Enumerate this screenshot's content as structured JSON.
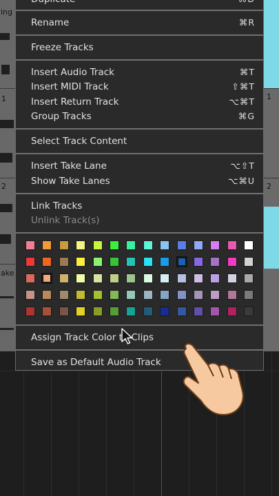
{
  "menu": {
    "items": {
      "duplicate": {
        "label": "Duplicate",
        "shortcut": "⌘D"
      },
      "rename": {
        "label": "Rename",
        "shortcut": "⌘R"
      },
      "freeze": {
        "label": "Freeze Tracks"
      },
      "insert_audio": {
        "label": "Insert Audio Track",
        "shortcut": "⌘T"
      },
      "insert_midi": {
        "label": "Insert MIDI Track",
        "shortcut": "⇧⌘T"
      },
      "insert_return": {
        "label": "Insert Return Track",
        "shortcut": "⌥⌘T"
      },
      "group": {
        "label": "Group Tracks",
        "shortcut": "⌘G"
      },
      "select_content": {
        "label": "Select Track Content"
      },
      "insert_take_lane": {
        "label": "Insert Take Lane",
        "shortcut": "⌥⇧T"
      },
      "show_take_lanes": {
        "label": "Show Take Lanes",
        "shortcut": "⌥⌘U"
      },
      "link": {
        "label": "Link Tracks"
      },
      "unlink": {
        "label": "Unlink Track(s)"
      },
      "assign_color": {
        "label": "Assign Track Color to Clips"
      },
      "save_default": {
        "label": "Save as Default Audio Track"
      }
    },
    "palette": [
      [
        "#f07f95",
        "#f29a35",
        "#c79b3f",
        "#f3f386",
        "#c5f53c",
        "#39f03b",
        "#3af09e",
        "#5ef4d9",
        "#89c5f2",
        "#5a7de6",
        "#90a8f5",
        "#d57ef2",
        "#e55ab0",
        "#ffffff"
      ],
      [
        "#f03838",
        "#f1661e",
        "#9c7a52",
        "#fbf03d",
        "#8cf372",
        "#36c533",
        "#24c3b2",
        "#2ae2f4",
        "#1c9ce8",
        "#1a61b1",
        "#8668e3",
        "#a671c6",
        "#f33ac3",
        "#d2d2d2"
      ],
      [
        "#d76a5d",
        "#f4a877",
        "#ceb06f",
        "#f3fda9",
        "#d6e3a0",
        "#bcd087",
        "#9cc58d",
        "#d8fbe2",
        "#d2f0f3",
        "#b6bfe2",
        "#cdbce6",
        "#bc9fe5",
        "#d5d1e2",
        "#a9a9a9"
      ],
      [
        "#c49488",
        "#b98a5a",
        "#9c8c6e",
        "#c1bb30",
        "#a3c031",
        "#84b95a",
        "#97c6b9",
        "#9db4c1",
        "#85a5c2",
        "#8392c8",
        "#a295b6",
        "#bd9ec7",
        "#b07798",
        "#7a7a7a"
      ],
      [
        "#ad3430",
        "#a75138",
        "#785449",
        "#e3d125",
        "#8a9d27",
        "#569c37",
        "#16a396",
        "#245b78",
        "#1a2c8f",
        "#3556a1",
        "#614fa9",
        "#a456ad",
        "#b0225f",
        "#3a3a3a"
      ]
    ],
    "selected_swatches": [
      "1-9",
      "2-1"
    ]
  },
  "background": {
    "lane_numbers": [
      "1",
      "2"
    ],
    "lane_labels": [
      "ing",
      "ake"
    ]
  }
}
